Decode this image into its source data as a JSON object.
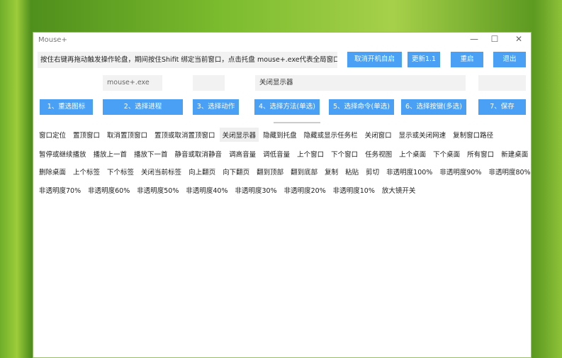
{
  "window": {
    "title": "Mouse+",
    "minimize": "—",
    "maximize": "☐",
    "close": "✕"
  },
  "hint": "按住右键再拖动触发操作轮盘，期间按住Shifit 绑定当前窗口，点击托盘 mouse+.exe代表全局窗口。",
  "top_buttons": [
    "取消开机自启",
    "更新1.1",
    "重启",
    "退出"
  ],
  "fields": {
    "process": "mouse+.exe",
    "action": "",
    "command": "关闭显示器",
    "keys": ""
  },
  "steps": [
    "1、重选图标",
    "2、选择进程",
    "3、选择动作",
    "4、选择方法(单选)",
    "5、选择命令(单选)",
    "6、选择按键(多选)",
    "7、保存"
  ],
  "selected_command": "关闭显示器",
  "commands": [
    [
      "窗口定位",
      "置顶窗口",
      "取消置顶窗口",
      "置顶或取消置顶窗口",
      "关闭显示器",
      "隐藏到托盘",
      "隐藏或显示任务栏",
      "关闭窗口",
      "显示或关闭网速",
      "复制窗口路径"
    ],
    [
      "暂停或继续播放",
      "播放上一首",
      "播放下一首",
      "静音或取消静音",
      "调高音量",
      "调低音量",
      "上个窗口",
      "下个窗口",
      "任务视图",
      "上个桌面",
      "下个桌面",
      "所有窗口",
      "新建桌面"
    ],
    [
      "删除桌面",
      "上个标签",
      "下个标签",
      "关闭当前标签",
      "向上翻页",
      "向下翻页",
      "翻到顶部",
      "翻到底部",
      "复制",
      "粘贴",
      "剪切",
      "非透明度100%",
      "非透明度90%",
      "非透明度80%"
    ],
    [
      "非透明度70%",
      "非透明度60%",
      "非透明度50%",
      "非透明度40%",
      "非透明度30%",
      "非透明度20%",
      "非透明度10%",
      "放大镜开关"
    ]
  ]
}
